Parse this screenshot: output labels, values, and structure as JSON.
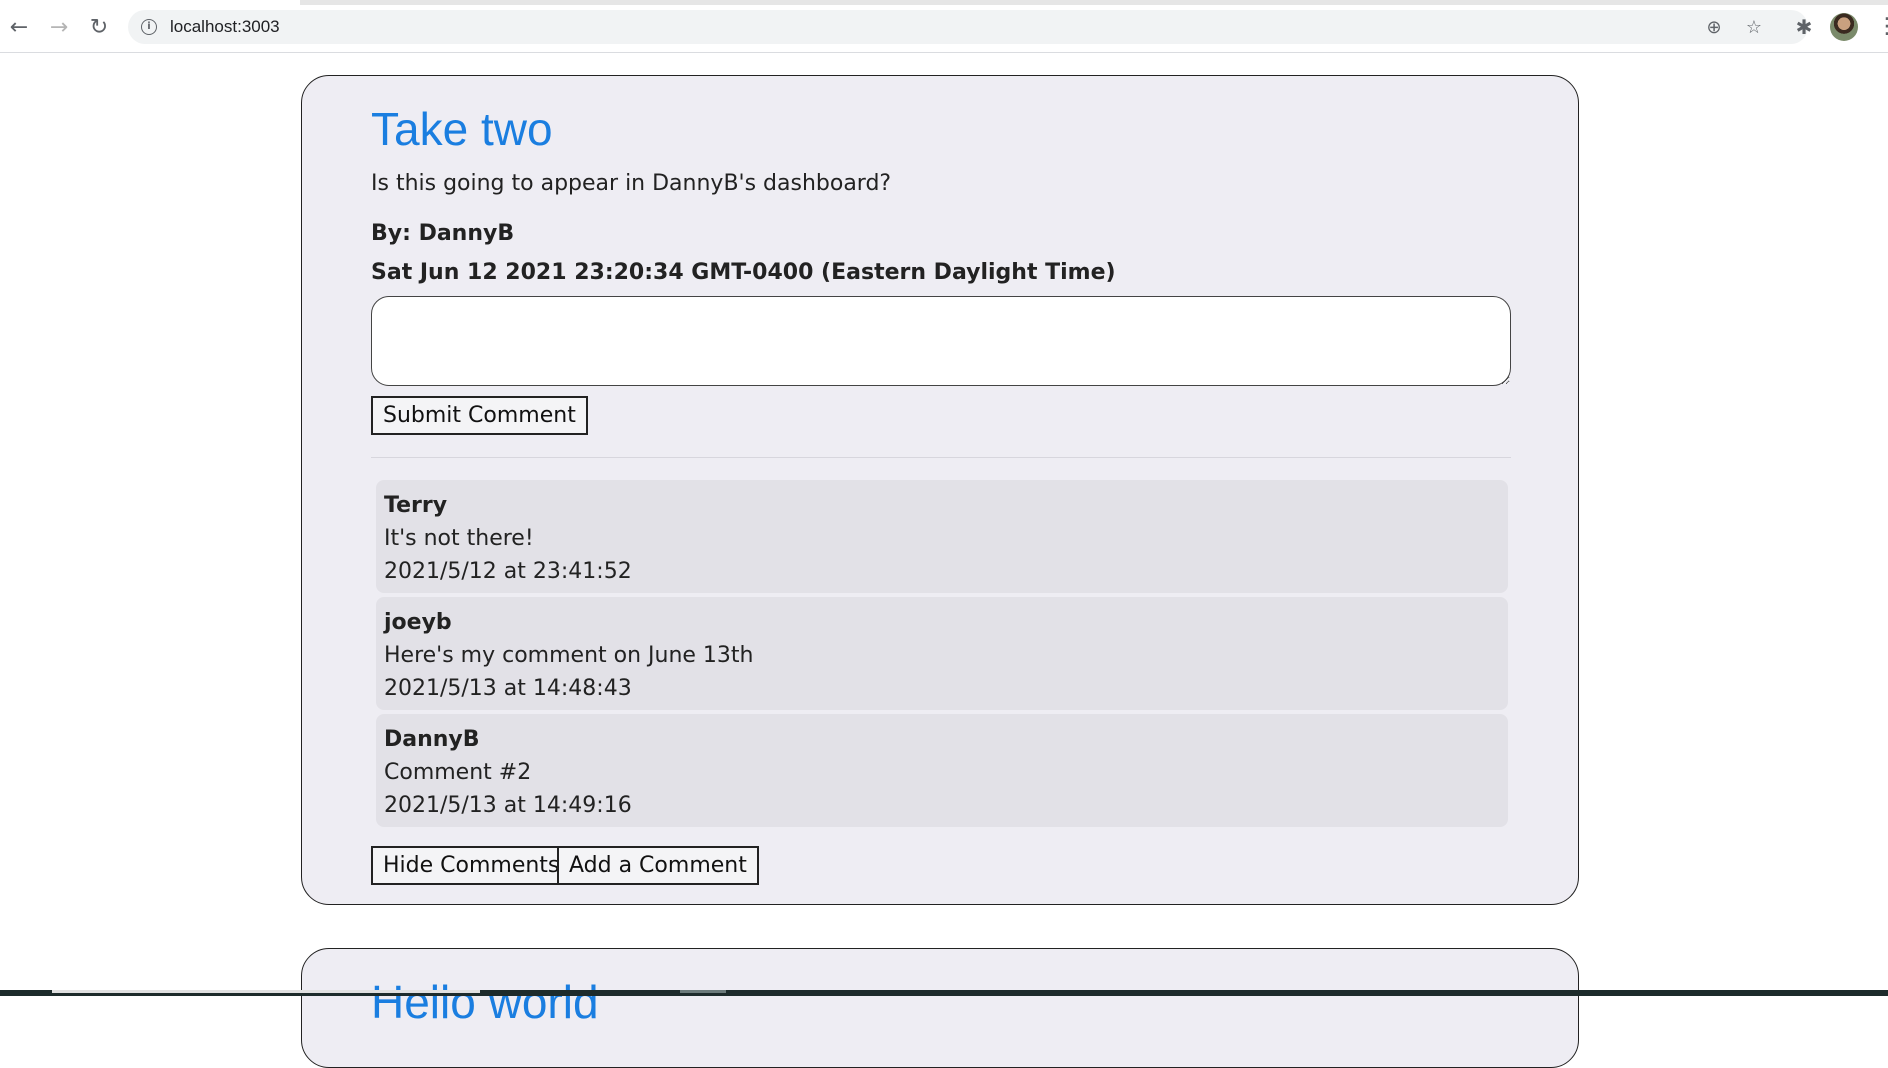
{
  "browser": {
    "url": "localhost:3003",
    "back_icon": "←",
    "forward_icon": "→",
    "reload_icon": "↻",
    "info_icon": "i",
    "zoom_icon": "⊕",
    "star_icon": "☆",
    "extensions_icon": "✱",
    "menu_icon": "⋮"
  },
  "post": {
    "title": "Take two",
    "body": "Is this going to appear in DannyB's dashboard?",
    "author": "By: DannyB",
    "date": "Sat Jun 12 2021 23:20:34 GMT-0400 (Eastern Daylight Time)",
    "comment_input": {
      "value": "",
      "placeholder": ""
    },
    "submit_label": "Submit Comment",
    "comments": [
      {
        "author": "Terry",
        "text": "It's not there!",
        "time": "2021/5/12 at 23:41:52"
      },
      {
        "author": "joeyb",
        "text": "Here's my comment on June 13th",
        "time": "2021/5/13 at 14:48:43"
      },
      {
        "author": "DannyB",
        "text": "Comment #2",
        "time": "2021/5/13 at 14:49:16"
      }
    ],
    "hide_comments_label": "Hide Comments",
    "add_comment_label": "Add a Comment"
  },
  "next_post": {
    "title": "Hello world"
  },
  "colors": {
    "title_blue": "#1a7ee0",
    "card_bg": "#eeedf3",
    "comment_bg": "#e2e1e7"
  }
}
